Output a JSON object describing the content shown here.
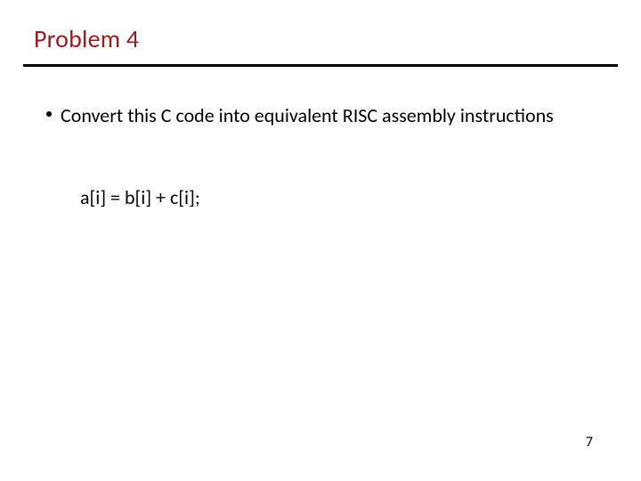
{
  "title": "Problem 4",
  "bullet": {
    "text": "Convert this C code into equivalent RISC assembly instructions"
  },
  "code_line": "a[i] = b[i] + c[i];",
  "page_number": "7"
}
